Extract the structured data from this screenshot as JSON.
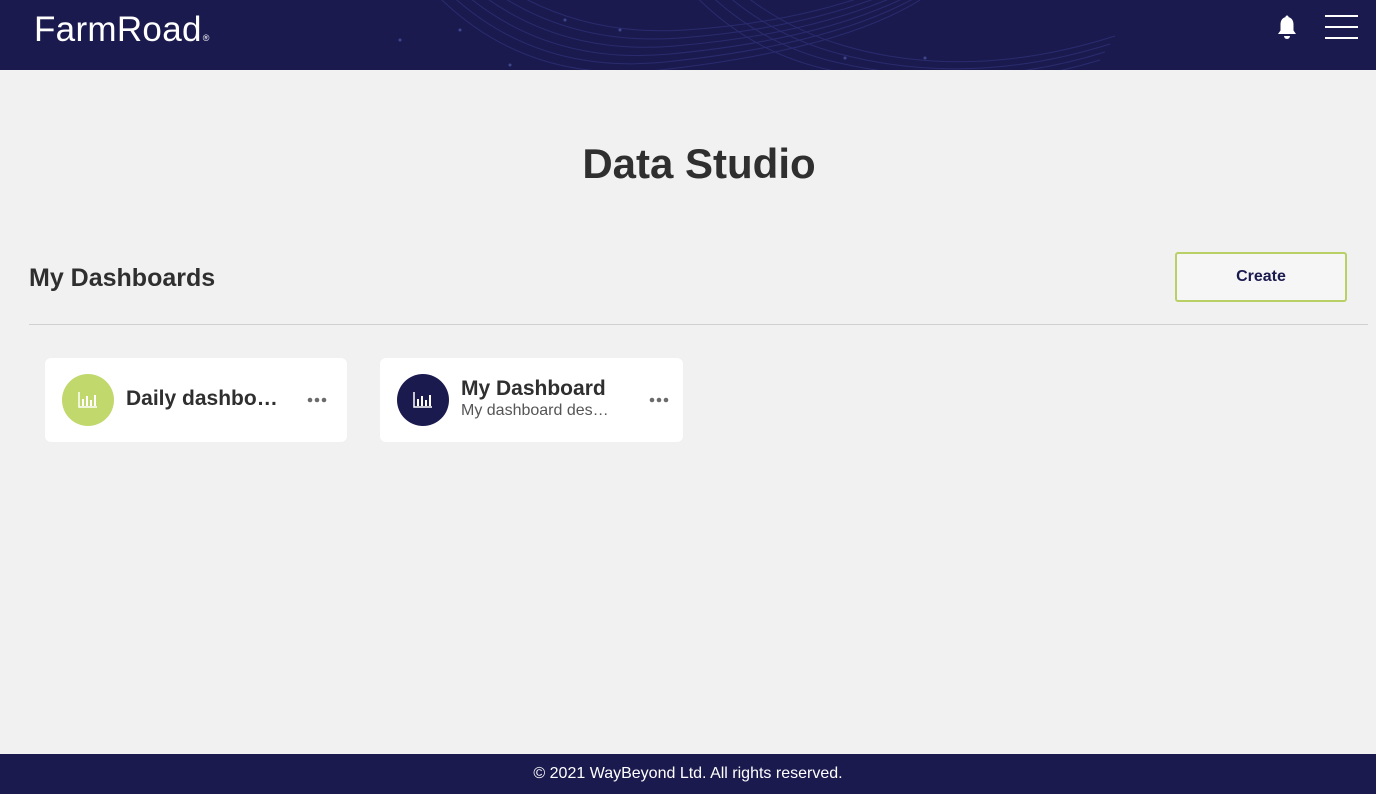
{
  "header": {
    "logo_text": "FarmRoad",
    "logo_mark": "®",
    "notification_icon": "bell-icon",
    "menu_icon": "hamburger-menu-icon"
  },
  "main": {
    "title": "Data Studio",
    "section_title": "My Dashboards",
    "create_label": "Create"
  },
  "dashboards": [
    {
      "title": "Daily dashboard",
      "description": "",
      "icon": "bar-chart-icon",
      "avatar_color": "#c1d86d"
    },
    {
      "title": "My Dashboard",
      "description": "My dashboard description",
      "icon": "bar-chart-icon",
      "avatar_color": "#1b1a4f"
    }
  ],
  "footer": {
    "copyright": "© 2021 WayBeyond Ltd. All rights reserved."
  },
  "colors": {
    "brand_navy": "#1b1a4f",
    "accent_green": "#b9d066",
    "background": "#f1f1f1"
  }
}
